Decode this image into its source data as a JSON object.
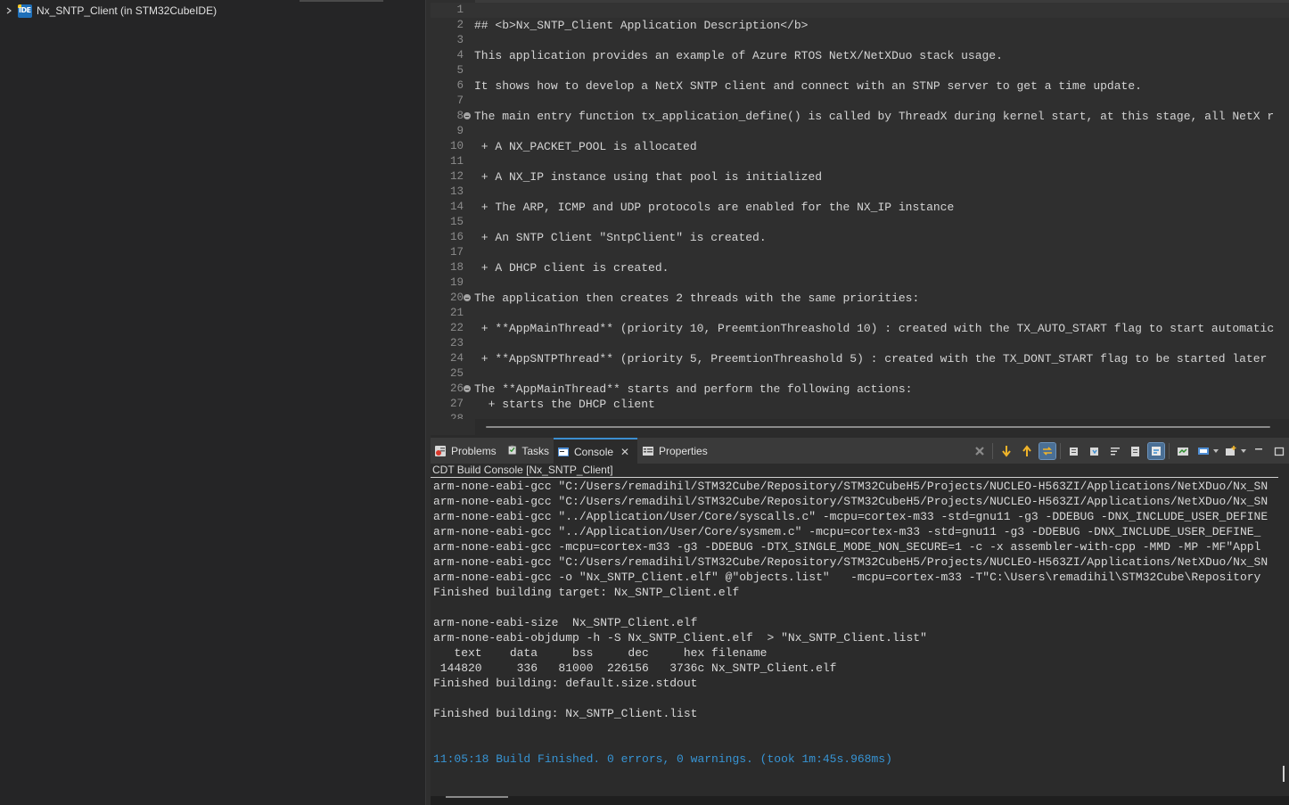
{
  "explorer": {
    "project_label": "Nx_SNTP_Client (in STM32CubeIDE)",
    "project_icon_text": "IDE"
  },
  "editor": {
    "lines": [
      {
        "n": "1",
        "text": "",
        "fold": false,
        "current": true
      },
      {
        "n": "2",
        "text": "## <b>Nx_SNTP_Client Application Description</b>",
        "fold": false
      },
      {
        "n": "3",
        "text": "",
        "fold": false
      },
      {
        "n": "4",
        "text": "This application provides an example of Azure RTOS NetX/NetXDuo stack usage.",
        "fold": false
      },
      {
        "n": "5",
        "text": "",
        "fold": false
      },
      {
        "n": "6",
        "text": "It shows how to develop a NetX SNTP client and connect with an STNP server to get a time update.",
        "fold": false
      },
      {
        "n": "7",
        "text": "",
        "fold": false
      },
      {
        "n": "8",
        "text": "The main entry function tx_application_define() is called by ThreadX during kernel start, at this stage, all NetX r",
        "fold": true
      },
      {
        "n": "9",
        "text": "",
        "fold": false
      },
      {
        "n": "10",
        "text": " + A NX_PACKET_POOL is allocated",
        "fold": false
      },
      {
        "n": "11",
        "text": "",
        "fold": false
      },
      {
        "n": "12",
        "text": " + A NX_IP instance using that pool is initialized",
        "fold": false
      },
      {
        "n": "13",
        "text": "",
        "fold": false
      },
      {
        "n": "14",
        "text": " + The ARP, ICMP and UDP protocols are enabled for the NX_IP instance",
        "fold": false
      },
      {
        "n": "15",
        "text": "",
        "fold": false
      },
      {
        "n": "16",
        "text": " + An SNTP Client \"SntpClient\" is created.",
        "fold": false
      },
      {
        "n": "17",
        "text": "",
        "fold": false
      },
      {
        "n": "18",
        "text": " + A DHCP client is created.",
        "fold": false
      },
      {
        "n": "19",
        "text": "",
        "fold": false
      },
      {
        "n": "20",
        "text": "The application then creates 2 threads with the same priorities:",
        "fold": true
      },
      {
        "n": "21",
        "text": "",
        "fold": false
      },
      {
        "n": "22",
        "text": " + **AppMainThread** (priority 10, PreemtionThreashold 10) : created with the TX_AUTO_START flag to start automatic",
        "fold": false
      },
      {
        "n": "23",
        "text": "",
        "fold": false
      },
      {
        "n": "24",
        "text": " + **AppSNTPThread** (priority 5, PreemtionThreashold 5) : created with the TX_DONT_START flag to be started later",
        "fold": false
      },
      {
        "n": "25",
        "text": "",
        "fold": false
      },
      {
        "n": "26",
        "text": "The **AppMainThread** starts and perform the following actions:",
        "fold": true
      },
      {
        "n": "27",
        "text": "  + starts the DHCP client",
        "fold": false
      },
      {
        "n": "28",
        "text": "",
        "fold": false
      }
    ]
  },
  "console": {
    "tabs": [
      {
        "label": "Problems",
        "icon": "problems-icon"
      },
      {
        "label": "Tasks",
        "icon": "tasks-icon"
      },
      {
        "label": "Console",
        "icon": "console-icon",
        "active": true
      },
      {
        "label": "Properties",
        "icon": "properties-icon"
      }
    ],
    "title": "CDT Build Console [Nx_SNTP_Client]",
    "lines": [
      {
        "text": "arm-none-eabi-gcc \"C:/Users/remadihil/STM32Cube/Repository/STM32CubeH5/Projects/NUCLEO-H563ZI/Applications/NetXDuo/Nx_SN"
      },
      {
        "text": "arm-none-eabi-gcc \"C:/Users/remadihil/STM32Cube/Repository/STM32CubeH5/Projects/NUCLEO-H563ZI/Applications/NetXDuo/Nx_SN"
      },
      {
        "text": "arm-none-eabi-gcc \"../Application/User/Core/syscalls.c\" -mcpu=cortex-m33 -std=gnu11 -g3 -DDEBUG -DNX_INCLUDE_USER_DEFINE"
      },
      {
        "text": "arm-none-eabi-gcc \"../Application/User/Core/sysmem.c\" -mcpu=cortex-m33 -std=gnu11 -g3 -DDEBUG -DNX_INCLUDE_USER_DEFINE_"
      },
      {
        "text": "arm-none-eabi-gcc -mcpu=cortex-m33 -g3 -DDEBUG -DTX_SINGLE_MODE_NON_SECURE=1 -c -x assembler-with-cpp -MMD -MP -MF\"Appl"
      },
      {
        "text": "arm-none-eabi-gcc \"C:/Users/remadihil/STM32Cube/Repository/STM32CubeH5/Projects/NUCLEO-H563ZI/Applications/NetXDuo/Nx_SN"
      },
      {
        "text": "arm-none-eabi-gcc -o \"Nx_SNTP_Client.elf\" @\"objects.list\"   -mcpu=cortex-m33 -T\"C:\\Users\\remadihil\\STM32Cube\\Repository"
      },
      {
        "text": "Finished building target: Nx_SNTP_Client.elf"
      },
      {
        "text": ""
      },
      {
        "text": "arm-none-eabi-size  Nx_SNTP_Client.elf"
      },
      {
        "text": "arm-none-eabi-objdump -h -S Nx_SNTP_Client.elf  > \"Nx_SNTP_Client.list\""
      },
      {
        "text": "   text    data     bss     dec     hex filename"
      },
      {
        "text": " 144820     336   81000  226156   3736c Nx_SNTP_Client.elf"
      },
      {
        "text": "Finished building: default.size.stdout"
      },
      {
        "text": ""
      },
      {
        "text": "Finished building: Nx_SNTP_Client.list"
      },
      {
        "text": ""
      },
      {
        "text": ""
      },
      {
        "text": "11:05:18 Build Finished. 0 errors, 0 warnings. (took 1m:45s.968ms)",
        "status": true
      }
    ]
  },
  "colors": {
    "status_text": "#3794d4",
    "active_tab_accent": "#3c8ed0"
  }
}
